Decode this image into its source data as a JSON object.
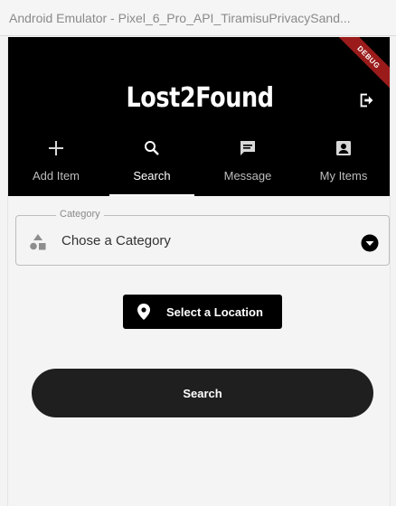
{
  "window": {
    "title": "Android Emulator - Pixel_6_Pro_API_TiramisuPrivacySand..."
  },
  "debug_banner": "DEBUG",
  "appbar": {
    "title": "Lost2Found",
    "logout_icon": "logout-icon"
  },
  "tabs": [
    {
      "label": "Add Item",
      "icon": "plus-icon",
      "active": false
    },
    {
      "label": "Search",
      "icon": "search-icon",
      "active": true
    },
    {
      "label": "Message",
      "icon": "message-icon",
      "active": false
    },
    {
      "label": "My Items",
      "icon": "account-box-icon",
      "active": false
    }
  ],
  "category": {
    "label": "Category",
    "value": "Chose a Category",
    "icon": "shapes-icon"
  },
  "location_button": {
    "label": "Select a Location",
    "icon": "location-pin-icon"
  },
  "search_button": {
    "label": "Search"
  },
  "colors": {
    "appbar_bg": "#000000",
    "button_bg": "#1f1f1f",
    "page_bg": "#f4f4f4"
  }
}
